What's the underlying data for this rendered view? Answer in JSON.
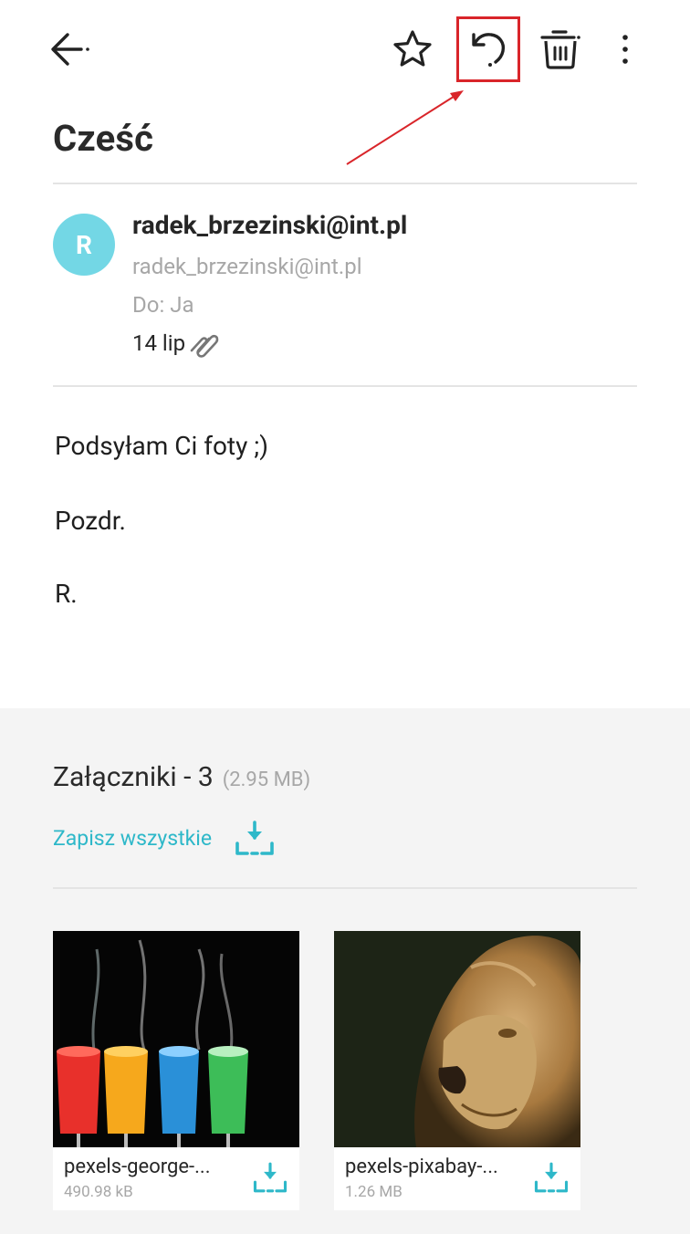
{
  "toolbar": {
    "icons": [
      "back-arrow-icon",
      "star-icon",
      "reply-icon",
      "trash-icon",
      "more-vert-icon"
    ],
    "highlight_color": "#d9252a"
  },
  "email": {
    "subject": "Cześć",
    "sender": {
      "initial": "R",
      "name": "radek_brzezinski@int.pl",
      "email": "radek_brzezinski@int.pl",
      "avatar_color": "#73d7e5"
    },
    "to": "Do: Ja",
    "date": "14 lip",
    "body": [
      "Podsyłam Ci foty ;)",
      "Pozdr.",
      "R."
    ]
  },
  "attachments": {
    "title": "Załączniki - 3",
    "total_size": "(2.95 MB)",
    "save_all_label": "Zapisz wszystkie",
    "accent_color": "#2eb8c9",
    "items": [
      {
        "name": "pexels-george-...",
        "size": "490.98 kB",
        "thumb": "colored-drinks-splash"
      },
      {
        "name": "pexels-pixabay-...",
        "size": "1.26 MB",
        "thumb": "lion-portrait"
      }
    ]
  }
}
